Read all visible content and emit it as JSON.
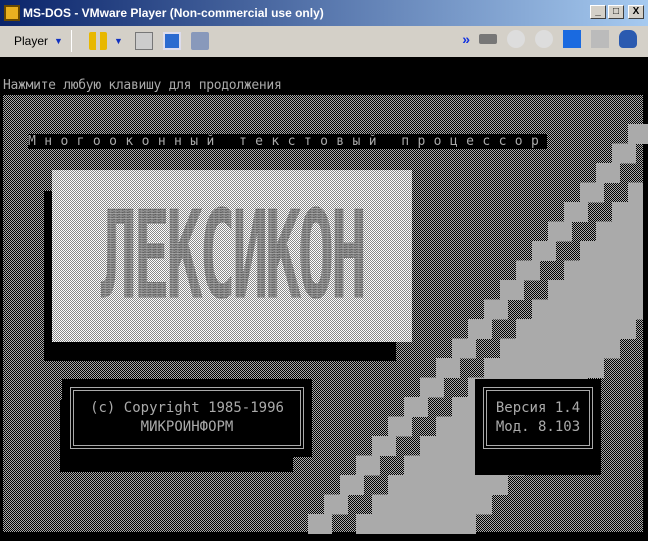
{
  "window": {
    "title": "MS-DOS - VMware Player (Non-commercial use only)",
    "minimize": "_",
    "maximize": "□",
    "close": "X"
  },
  "toolbar": {
    "player_label": "Player",
    "icons": [
      "pause-icon",
      "send-ctrl-alt-del-icon",
      "fullscreen-icon",
      "unity-icon",
      "more-icon",
      "hard-disk-icon",
      "cd-icon",
      "cd-icon",
      "floppy-icon",
      "network-icon",
      "sound-icon"
    ]
  },
  "dos": {
    "prompt": "Нажмите любую клавишу для продолжения",
    "subtitle": "Многооконный текстовый процессор",
    "logo": "ЛЕКСИКОН",
    "copyright_line1": "(c) Copyright 1985-1996",
    "copyright_line2": "МИКРОИНФОРМ",
    "version_line1": "Версия 1.4",
    "version_line2": "Мод. 8.103"
  },
  "colors": {
    "title_start": "#0a246a",
    "title_end": "#a6caf0",
    "dos_grey": "#aaaaaa"
  }
}
